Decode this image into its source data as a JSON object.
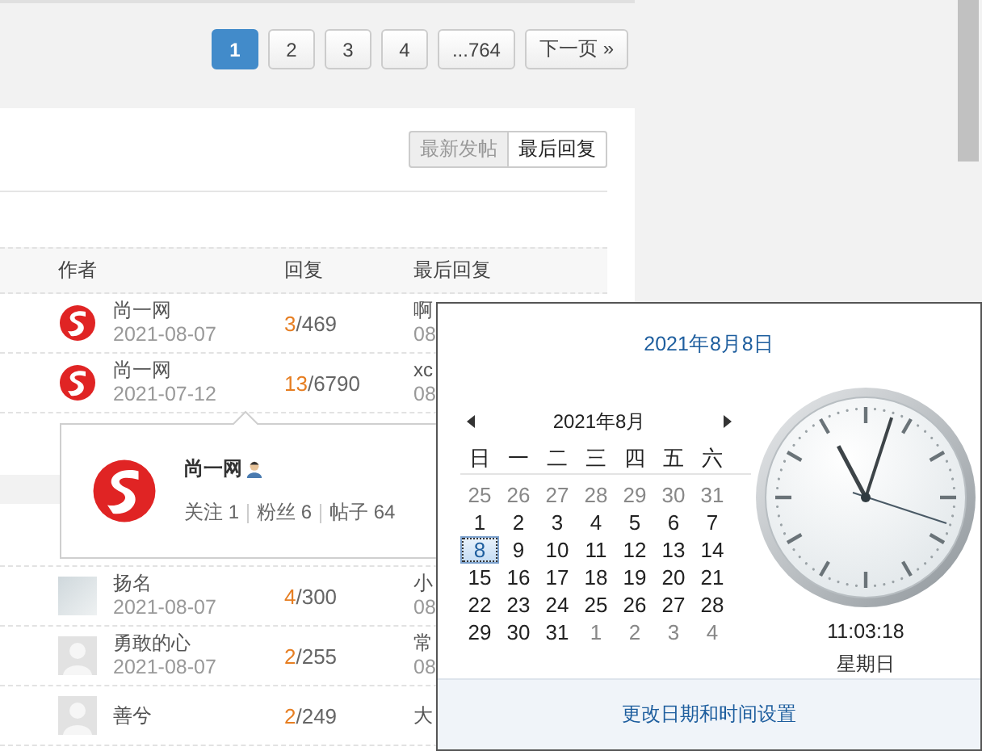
{
  "pagination": {
    "pages": [
      {
        "label": "1",
        "selected": true
      },
      {
        "label": "2",
        "selected": false
      },
      {
        "label": "3",
        "selected": false
      },
      {
        "label": "4",
        "selected": false
      },
      {
        "label": "...764",
        "selected": false
      },
      {
        "label": "下一页 »",
        "selected": false
      }
    ]
  },
  "sort_tabs": [
    {
      "label": "最新发帖",
      "selected": false
    },
    {
      "label": "最后回复",
      "selected": true
    }
  ],
  "table": {
    "columns": [
      "作者",
      "回复",
      "最后回复"
    ],
    "rows": [
      {
        "kind": "logo",
        "author": "尚一网",
        "date": "2021-08-07",
        "replies": "3",
        "total": "/469",
        "last_reply": "啊",
        "last_date": "08"
      },
      {
        "kind": "logo",
        "author": "尚一网",
        "date": "2021-07-12",
        "replies": "13",
        "total": "/6790",
        "last_reply": "xc",
        "last_date": "08"
      },
      {
        "kind": "photo",
        "author": "扬名",
        "date": "2021-08-07",
        "replies": "4",
        "total": "/300",
        "last_reply": "小",
        "last_date": "08"
      },
      {
        "kind": "default",
        "author": "勇敢的心",
        "date": "2021-08-07",
        "replies": "2",
        "total": "/255",
        "last_reply": "常",
        "last_date": "08"
      },
      {
        "kind": "default",
        "author": "善兮",
        "replies": "2",
        "total": "/249",
        "last_reply": "大"
      }
    ]
  },
  "user_card": {
    "name": "尚一网",
    "stats": [
      "关注 1",
      "粉丝 6",
      "帖子 64"
    ]
  },
  "calendar": {
    "title": "2021年8月8日",
    "month": "2021年8月",
    "weekdays": [
      "日",
      "一",
      "二",
      "三",
      "四",
      "五",
      "六"
    ],
    "days": [
      {
        "label": "25",
        "other_month": true,
        "selected": false
      },
      {
        "label": "26",
        "other_month": true,
        "selected": false
      },
      {
        "label": "27",
        "other_month": true,
        "selected": false
      },
      {
        "label": "28",
        "other_month": true,
        "selected": false
      },
      {
        "label": "29",
        "other_month": true,
        "selected": false
      },
      {
        "label": "30",
        "other_month": true,
        "selected": false
      },
      {
        "label": "31",
        "other_month": true,
        "selected": false
      },
      {
        "label": "1",
        "other_month": false,
        "selected": false
      },
      {
        "label": "2",
        "other_month": false,
        "selected": false
      },
      {
        "label": "3",
        "other_month": false,
        "selected": false
      },
      {
        "label": "4",
        "other_month": false,
        "selected": false
      },
      {
        "label": "5",
        "other_month": false,
        "selected": false
      },
      {
        "label": "6",
        "other_month": false,
        "selected": false
      },
      {
        "label": "7",
        "other_month": false,
        "selected": false
      },
      {
        "label": "8",
        "other_month": false,
        "selected": true
      },
      {
        "label": "9",
        "other_month": false,
        "selected": false
      },
      {
        "label": "10",
        "other_month": false,
        "selected": false
      },
      {
        "label": "11",
        "other_month": false,
        "selected": false
      },
      {
        "label": "12",
        "other_month": false,
        "selected": false
      },
      {
        "label": "13",
        "other_month": false,
        "selected": false
      },
      {
        "label": "14",
        "other_month": false,
        "selected": false
      },
      {
        "label": "15",
        "other_month": false,
        "selected": false
      },
      {
        "label": "16",
        "other_month": false,
        "selected": false
      },
      {
        "label": "17",
        "other_month": false,
        "selected": false
      },
      {
        "label": "18",
        "other_month": false,
        "selected": false
      },
      {
        "label": "19",
        "other_month": false,
        "selected": false
      },
      {
        "label": "20",
        "other_month": false,
        "selected": false
      },
      {
        "label": "21",
        "other_month": false,
        "selected": false
      },
      {
        "label": "22",
        "other_month": false,
        "selected": false
      },
      {
        "label": "23",
        "other_month": false,
        "selected": false
      },
      {
        "label": "24",
        "other_month": false,
        "selected": false
      },
      {
        "label": "25",
        "other_month": false,
        "selected": false
      },
      {
        "label": "26",
        "other_month": false,
        "selected": false
      },
      {
        "label": "27",
        "other_month": false,
        "selected": false
      },
      {
        "label": "28",
        "other_month": false,
        "selected": false
      },
      {
        "label": "29",
        "other_month": false,
        "selected": false
      },
      {
        "label": "30",
        "other_month": false,
        "selected": false
      },
      {
        "label": "31",
        "other_month": false,
        "selected": false
      },
      {
        "label": "1",
        "other_month": true,
        "selected": false
      },
      {
        "label": "2",
        "other_month": true,
        "selected": false
      },
      {
        "label": "3",
        "other_month": true,
        "selected": false
      },
      {
        "label": "4",
        "other_month": true,
        "selected": false
      }
    ],
    "time": "11:03:18",
    "weekday": "星期日",
    "link": "更改日期和时间设置"
  }
}
